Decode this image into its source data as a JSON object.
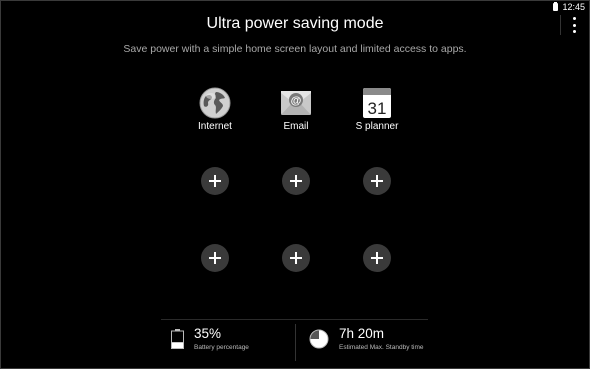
{
  "status_bar": {
    "time": "12:45"
  },
  "header": {
    "title": "Ultra power saving mode",
    "subtitle": "Save power with a simple home screen layout and limited access to apps."
  },
  "apps": [
    {
      "label": "Internet",
      "icon": "globe-icon"
    },
    {
      "label": "Email",
      "icon": "email-icon"
    },
    {
      "label": "S planner",
      "icon": "calendar-icon",
      "icon_text": "31"
    }
  ],
  "add_slots": 6,
  "footer": {
    "battery": {
      "value": "35%",
      "label": "Battery percentage",
      "level": 0.35
    },
    "standby": {
      "value": "7h 20m",
      "label": "Estimated Max. Standby time"
    }
  },
  "colors": {
    "background": "#000000",
    "add_button": "#3a3a3a",
    "subtitle": "#a8a8a8"
  }
}
